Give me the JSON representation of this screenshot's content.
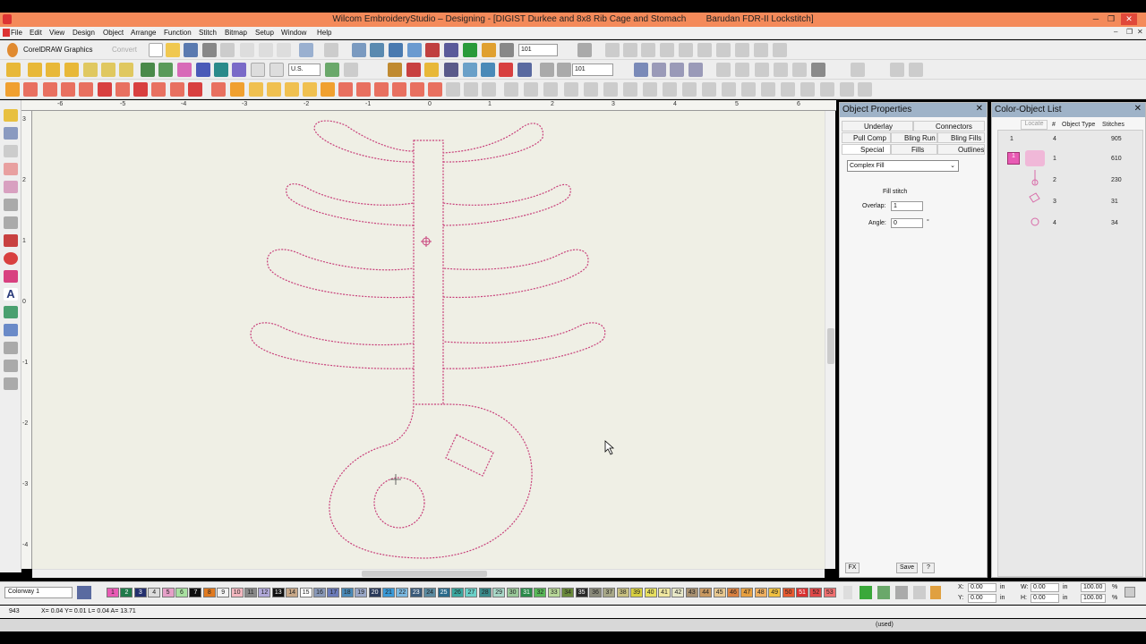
{
  "window": {
    "title": "Wilcom EmbroideryStudio – Designing - [DIGIST Durkee and 8x8 Rib Cage and Stomach",
    "machine": "Barudan FDR-II Lockstitch]"
  },
  "menu": [
    "File",
    "Edit",
    "View",
    "Design",
    "Object",
    "Arrange",
    "Function",
    "Stitch",
    "Bitmap",
    "Setup",
    "Window",
    "Help"
  ],
  "toolbar": {
    "corel_label": "CorelDRAW Graphics",
    "convert_label": "Convert",
    "zoom_value_1": "101",
    "zoom_value_2": "101",
    "units_value": "U.S."
  },
  "ruler": {
    "top": [
      "-6",
      "-5",
      "-4",
      "-3",
      "-2",
      "-1",
      "0",
      "1",
      "2",
      "3",
      "4",
      "5",
      "6"
    ],
    "left": [
      "3",
      "2",
      "1",
      "0",
      "-1",
      "-2",
      "-3",
      "-4"
    ]
  },
  "object_properties": {
    "title": "Object Properties",
    "tabs_row1": [
      "Underlay",
      "Connectors"
    ],
    "tabs_row2": [
      "Pull Comp",
      "Bling Run",
      "Bling Fills"
    ],
    "tabs_row3": [
      "Special",
      "Fills",
      "Outlines"
    ],
    "fill_type": "Complex Fill",
    "section_label": "Fill stitch",
    "overlap_label": "Overlap:",
    "overlap_value": "1",
    "angle_label": "Angle:",
    "angle_value": "0",
    "angle_unit": "°",
    "fx_label": "FX",
    "save_label": "Save",
    "help_label": "?"
  },
  "color_object_list": {
    "title": "Color-Object List",
    "locate_label": "Locate",
    "headers": [
      "#",
      "Object Type",
      "Stitches"
    ],
    "summary": {
      "num": "1",
      "count": "4",
      "stitches": "905"
    },
    "rows": [
      {
        "num": "1",
        "stitches": "610"
      },
      {
        "num": "2",
        "stitches": "230"
      },
      {
        "num": "3",
        "stitches": "31"
      },
      {
        "num": "4",
        "stitches": "34"
      }
    ]
  },
  "palette": {
    "colorway": "Colorway 1",
    "swatches": [
      {
        "n": "1",
        "c": "#e85ab4"
      },
      {
        "n": "2",
        "c": "#1f7a4a"
      },
      {
        "n": "3",
        "c": "#24306e"
      },
      {
        "n": "4",
        "c": "#dcdcdc"
      },
      {
        "n": "5",
        "c": "#e6a0c8"
      },
      {
        "n": "6",
        "c": "#a8e0a0"
      },
      {
        "n": "7",
        "c": "#111111"
      },
      {
        "n": "8",
        "c": "#e07a20"
      },
      {
        "n": "9",
        "c": "#f2f2f2"
      },
      {
        "n": "10",
        "c": "#f4b8c0"
      },
      {
        "n": "11",
        "c": "#888888"
      },
      {
        "n": "12",
        "c": "#b0a8d8"
      },
      {
        "n": "13",
        "c": "#111111"
      },
      {
        "n": "14",
        "c": "#c8a888"
      },
      {
        "n": "15",
        "c": "#ffffff"
      },
      {
        "n": "16",
        "c": "#8898b8"
      },
      {
        "n": "17",
        "c": "#6a7ab8"
      },
      {
        "n": "18",
        "c": "#4a8ab8"
      },
      {
        "n": "19",
        "c": "#9aa8c8"
      },
      {
        "n": "20",
        "c": "#2a3a5a"
      },
      {
        "n": "21",
        "c": "#3a9ad8"
      },
      {
        "n": "22",
        "c": "#7ab8e0"
      },
      {
        "n": "23",
        "c": "#3a5a7a"
      },
      {
        "n": "24",
        "c": "#5a8aa0"
      },
      {
        "n": "25",
        "c": "#2a6a8a"
      },
      {
        "n": "26",
        "c": "#3aa8a0"
      },
      {
        "n": "27",
        "c": "#6ad0c8"
      },
      {
        "n": "28",
        "c": "#3a8a8a"
      },
      {
        "n": "29",
        "c": "#a8d8c8"
      },
      {
        "n": "30",
        "c": "#98c898"
      },
      {
        "n": "31",
        "c": "#2a8a4a"
      },
      {
        "n": "32",
        "c": "#58b858"
      },
      {
        "n": "33",
        "c": "#b8d898"
      },
      {
        "n": "34",
        "c": "#6a8a3a"
      },
      {
        "n": "35",
        "c": "#2a2a2a"
      },
      {
        "n": "36",
        "c": "#8a8a7a"
      },
      {
        "n": "37",
        "c": "#a8a888"
      },
      {
        "n": "38",
        "c": "#c8c080"
      },
      {
        "n": "39",
        "c": "#d8d040"
      },
      {
        "n": "40",
        "c": "#e8e060"
      },
      {
        "n": "41",
        "c": "#f0e8a0"
      },
      {
        "n": "42",
        "c": "#e8e8c8"
      },
      {
        "n": "43",
        "c": "#a89070"
      },
      {
        "n": "44",
        "c": "#c89860"
      },
      {
        "n": "45",
        "c": "#e8c890"
      },
      {
        "n": "46",
        "c": "#d88040"
      },
      {
        "n": "47",
        "c": "#e8a040"
      },
      {
        "n": "48",
        "c": "#f0b060"
      },
      {
        "n": "49",
        "c": "#f0c040"
      },
      {
        "n": "50",
        "c": "#e85a30"
      },
      {
        "n": "51",
        "c": "#d83030"
      },
      {
        "n": "52",
        "c": "#e04848"
      },
      {
        "n": "53",
        "c": "#f07070"
      }
    ]
  },
  "coords": {
    "x_label": "X:",
    "x_value": "0.00",
    "y_label": "Y:",
    "y_value": "0.00",
    "w_label": "W:",
    "w_value": "0.00",
    "h_label": "H:",
    "h_value": "0.00",
    "unit": "in",
    "pct1": "100.00",
    "pct2": "100.00",
    "pct_unit": "%"
  },
  "status": {
    "stitches": "943",
    "info": "X= 0.04 Y= 0.01 L= 0.04 A= 13.71",
    "used": "(used)"
  }
}
